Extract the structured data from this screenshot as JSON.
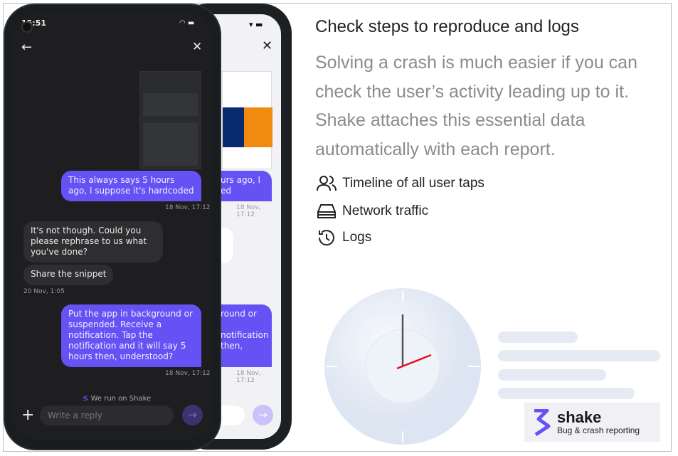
{
  "phone": {
    "status_time": "15:51",
    "messages": [
      {
        "text": "This always says 5 hours ago, I suppose it's hardcoded",
        "time": "18 Nov, 17:12",
        "from": "user"
      },
      {
        "text": "It's not though. Could you please rephrase to us what you've done?",
        "from": "support"
      },
      {
        "text": "Share the snippet",
        "time": "20 Nov, 1:05",
        "from": "support"
      },
      {
        "text": "Put the app in background or suspended. Receive a notification. Tap the notification and it will say 5 hours then, understood?",
        "time": "18 Nov, 17:12",
        "from": "user"
      }
    ],
    "footer": "We run on Shake",
    "reply_placeholder": "Write a reply"
  },
  "back_phone": {
    "fragment_1": "urs ago, I",
    "fragment_2": "ed",
    "time_1": "18 Nov, 17:12",
    "fragment_3": "round or",
    "fragment_4": "notification",
    "fragment_5": "then,",
    "time_2": "18 Nov, 17:12"
  },
  "content": {
    "title": "Check steps to reproduce and logs",
    "paragraph": "Solving a crash is much easier if you can check the user’s activity leading up to it. Shake attaches this essential data automatically with each report.",
    "features": [
      {
        "icon": "users-icon",
        "label": "Timeline of all user taps"
      },
      {
        "icon": "network-icon",
        "label": "Network traffic"
      },
      {
        "icon": "history-icon",
        "label": "Logs"
      }
    ]
  },
  "brand": {
    "name": "shake",
    "tagline": "Bug & crash reporting",
    "accent": "#6552f5"
  }
}
